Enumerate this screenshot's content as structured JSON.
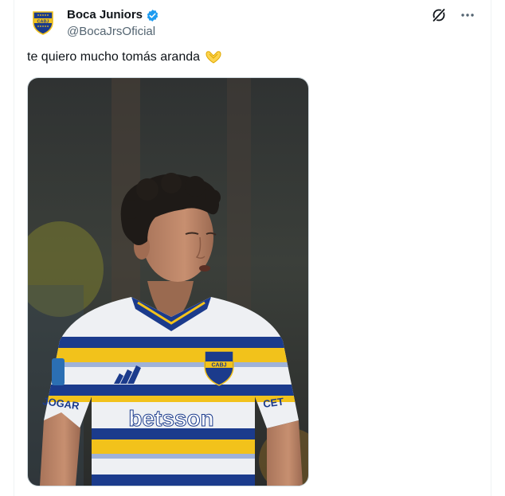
{
  "account": {
    "display_name": "Boca Juniors",
    "handle": "@BocaJrsOficial",
    "avatar_text": "CABJ",
    "verified": true
  },
  "post": {
    "text": "te quiero mucho tomás aranda",
    "emoji": "heart-hands-icon"
  },
  "media": {
    "jersey_sponsor": "betsson",
    "crest_text": "CABJ",
    "sleeve_left": "JOGAR",
    "sleeve_right": "CET"
  },
  "icons": {
    "grok": "grok-icon",
    "more": "more-options-icon"
  },
  "colors": {
    "verified_blue": "#1d9bf0",
    "boca_blue": "#1b3b8c",
    "boca_yellow": "#f2c21b"
  }
}
